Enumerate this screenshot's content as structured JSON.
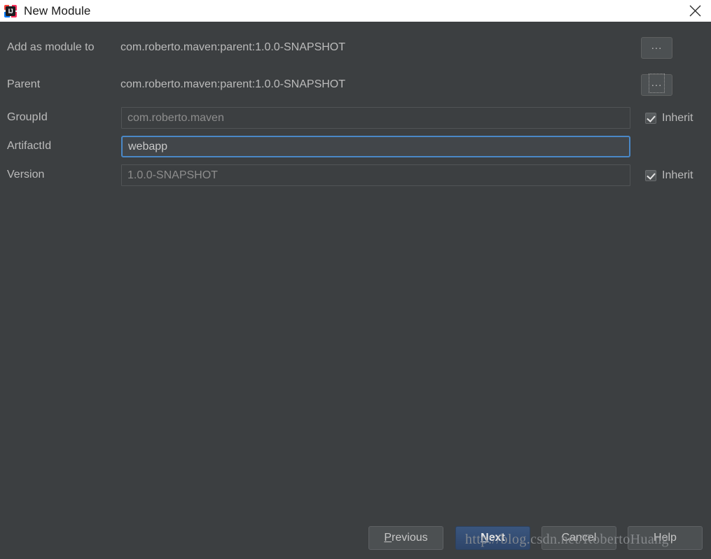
{
  "window": {
    "title": "New Module",
    "app_icon": "intellij-idea-icon",
    "close_icon": "close-icon"
  },
  "form": {
    "add_as_module": {
      "label": "Add as module to",
      "value": "com.roberto.maven:parent:1.0.0-SNAPSHOT",
      "browse_label": "...",
      "browse_icon": "ellipsis-icon"
    },
    "parent": {
      "label": "Parent",
      "value": "com.roberto.maven:parent:1.0.0-SNAPSHOT",
      "browse_label": "...",
      "browse_icon": "ellipsis-icon"
    },
    "group_id": {
      "label": "GroupId",
      "value": "com.roberto.maven",
      "placeholder": "com.roberto.maven",
      "inherit_label": "Inherit",
      "inherit_checked": true
    },
    "artifact_id": {
      "label": "ArtifactId",
      "value": "webapp",
      "placeholder": "webapp"
    },
    "version": {
      "label": "Version",
      "value": "1.0.0-SNAPSHOT",
      "placeholder": "1.0.0-SNAPSHOT",
      "inherit_label": "Inherit",
      "inherit_checked": true
    }
  },
  "buttons": {
    "previous": {
      "mnemonic": "P",
      "rest": "revious"
    },
    "next": {
      "mnemonic": "N",
      "rest": "ext"
    },
    "cancel": {
      "label": "Cancel"
    },
    "help": {
      "label": "Help"
    }
  },
  "watermark": {
    "text": "http://blog.csdn.net/RobertoHuang"
  },
  "colors": {
    "dialog_background": "#3c3f41",
    "titlebar_background": "#ffffff",
    "accent_focus": "#4a88c7",
    "primary_button": "#34507a",
    "label_text": "#bbbbbb"
  }
}
